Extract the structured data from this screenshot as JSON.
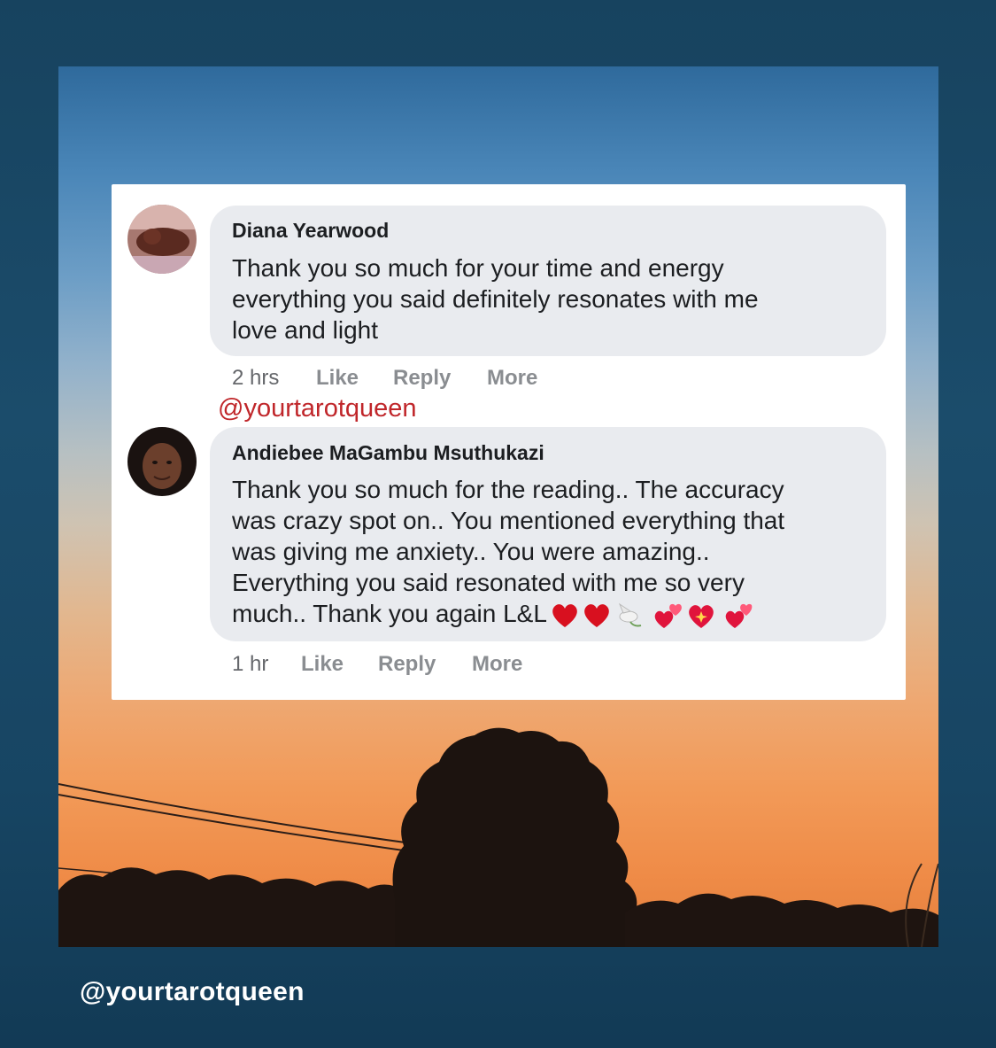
{
  "post": {
    "watermark": "@yourtarotqueen",
    "footer_handle": "@yourtarotqueen"
  },
  "comments": [
    {
      "author": "Diana Yearwood",
      "lines": [
        "Thank you so much for your time and energy",
        "everything you said definitely resonates with me",
        "love and light"
      ],
      "time": "2 hrs",
      "like": "Like",
      "reply": "Reply",
      "more": "More"
    },
    {
      "author": "Andiebee MaGambu Msuthukazi",
      "lines": [
        "Thank you so much for the reading.. The accuracy",
        "was crazy spot on.. You mentioned everything that",
        "was giving me anxiety.. You were amazing..",
        "Everything you said resonated with me so very",
        "much.. Thank you again L&L"
      ],
      "emojis": [
        "red-heart",
        "red-heart",
        "dove",
        "revolving-hearts",
        "sparkling-heart",
        "revolving-hearts"
      ],
      "time": "1 hr",
      "like": "Like",
      "reply": "Reply",
      "more": "More"
    }
  ],
  "colors": {
    "bubble": "#e9ebef",
    "watermark": "#c0262a",
    "meta": "#8a8d91"
  }
}
